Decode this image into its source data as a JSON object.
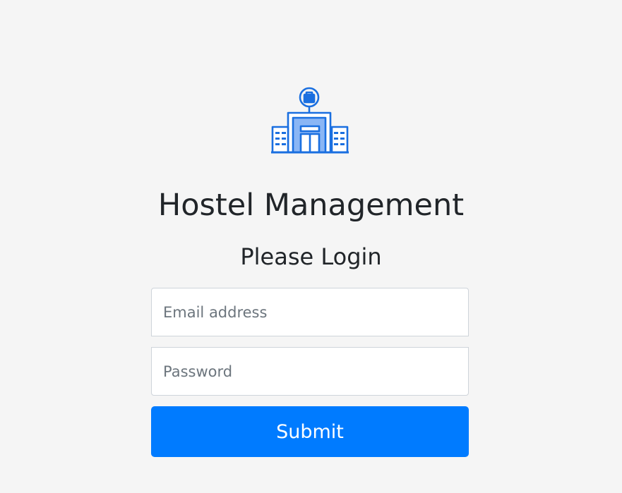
{
  "app": {
    "title": "Hostel Management",
    "subtitle": "Please Login",
    "logo_icon": "hotel-building-icon"
  },
  "form": {
    "email_placeholder": "Email address",
    "password_placeholder": "Password",
    "submit_label": "Submit"
  },
  "colors": {
    "background": "#f5f5f5",
    "primary": "#007bff",
    "icon_blue": "#1a6fe0",
    "icon_fill": "#8ab6f5"
  }
}
